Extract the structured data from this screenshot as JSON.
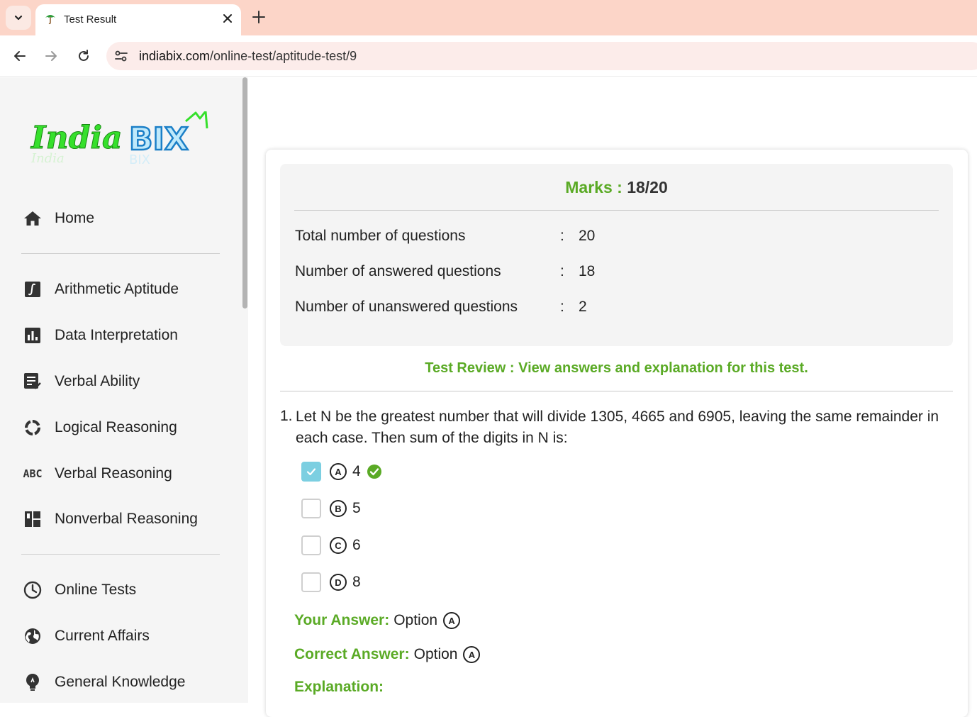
{
  "browser": {
    "tab_title": "Test Result",
    "url_host": "indiabix.com",
    "url_path": "/online-test/aptitude-test/9"
  },
  "sidebar": {
    "logo_text": "IndiaBIX",
    "items": [
      {
        "label": "Home",
        "icon": "home-icon"
      },
      {
        "label": "Arithmetic Aptitude",
        "icon": "integral-icon"
      },
      {
        "label": "Data Interpretation",
        "icon": "bar-chart-icon"
      },
      {
        "label": "Verbal Ability",
        "icon": "checklist-icon"
      },
      {
        "label": "Logical Reasoning",
        "icon": "cycle-icon"
      },
      {
        "label": "Verbal Reasoning",
        "icon": "abc-icon"
      },
      {
        "label": "Nonverbal Reasoning",
        "icon": "layout-icon"
      },
      {
        "label": "Online Tests",
        "icon": "clock-icon"
      },
      {
        "label": "Current Affairs",
        "icon": "globe-icon"
      },
      {
        "label": "General Knowledge",
        "icon": "lightbulb-icon"
      }
    ],
    "abc_icon_text": "ABC"
  },
  "result": {
    "marks_label": "Marks :",
    "marks_value": "18/20",
    "rows": [
      {
        "label": "Total number of questions",
        "colon": ":",
        "value": "20"
      },
      {
        "label": "Number of answered questions",
        "colon": ":",
        "value": "18"
      },
      {
        "label": "Number of unanswered questions",
        "colon": ":",
        "value": "2"
      }
    ],
    "review_text": "Test Review : View answers and explanation for this test."
  },
  "question": {
    "number": "1.",
    "text": "Let N be the greatest number that will divide 1305, 4665 and 6905, leaving the same remainder in each case. Then sum of the digits in N is:",
    "options": [
      {
        "letter": "A",
        "value": "4",
        "checked": true,
        "correct": true
      },
      {
        "letter": "B",
        "value": "5",
        "checked": false,
        "correct": false
      },
      {
        "letter": "C",
        "value": "6",
        "checked": false,
        "correct": false
      },
      {
        "letter": "D",
        "value": "8",
        "checked": false,
        "correct": false
      }
    ],
    "your_answer_label": "Your Answer:",
    "your_answer_text": "Option",
    "your_answer_letter": "A",
    "correct_answer_label": "Correct Answer:",
    "correct_answer_text": "Option",
    "correct_answer_letter": "A",
    "explanation_label": "Explanation:"
  },
  "colors": {
    "accent_green": "#5aaa25",
    "checkbox_blue": "#7ccfe1",
    "tabbar_bg": "#fcd5c8"
  }
}
